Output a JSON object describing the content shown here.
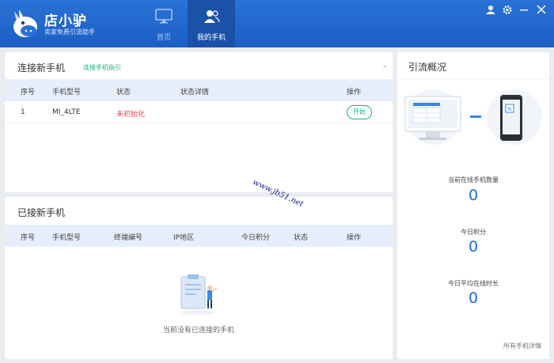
{
  "app": {
    "name": "店小驴",
    "subtitle": "卖家免费引流助手"
  },
  "nav": [
    {
      "label": "首页",
      "icon": "monitor-icon",
      "active": false
    },
    {
      "label": "我的手机",
      "icon": "users-icon",
      "active": true
    }
  ],
  "window_controls": [
    "user-icon",
    "gear-icon",
    "minimize-icon",
    "close-icon"
  ],
  "new_phones": {
    "title": "连接新手机",
    "guide_link": "连接手机指引",
    "columns": [
      "序号",
      "手机型号",
      "状态",
      "状态详情",
      "操作"
    ],
    "rows": [
      {
        "index": "1",
        "model": "MI_4LTE",
        "status": "未初始化",
        "detail": "",
        "action": "开始"
      }
    ]
  },
  "connected_phones": {
    "title": "已接新手机",
    "columns": [
      "序号",
      "手机型号",
      "终端编号",
      "IP地区",
      "今日积分",
      "状态",
      "操作"
    ],
    "empty_text": "当前没有已连接的手机"
  },
  "overview": {
    "title": "引流概况",
    "stats": [
      {
        "label": "当前在线手机数量",
        "value": "0"
      },
      {
        "label": "今日积分",
        "value": "0"
      },
      {
        "label": "今日平均在线时长",
        "value": "0"
      }
    ],
    "details_link": "所有手机详情"
  },
  "watermark": "www.jb51.net",
  "colors": {
    "header": "#1b5fc4",
    "accent_green": "#19b27b",
    "status_red": "#e84b4b",
    "stat_blue": "#1b6bd6"
  }
}
